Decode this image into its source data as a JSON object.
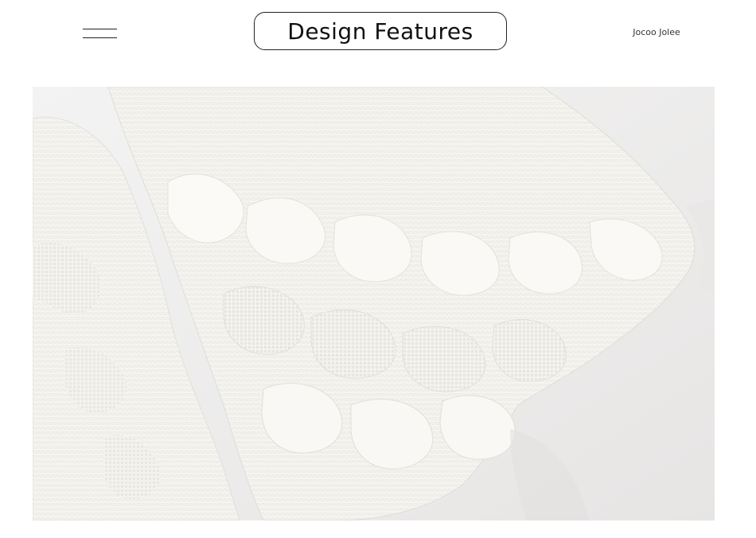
{
  "header": {
    "title": "Design Features",
    "brand": "Jocoo Jolee",
    "menu_icon": "hamburger-menu-icon"
  },
  "photo": {
    "subject": "white-knit-scalloped-sleeve-closeup",
    "colors": {
      "knit": "#f7f6f2",
      "background": "#eceae9",
      "shadow": "#dcd9d6"
    }
  }
}
